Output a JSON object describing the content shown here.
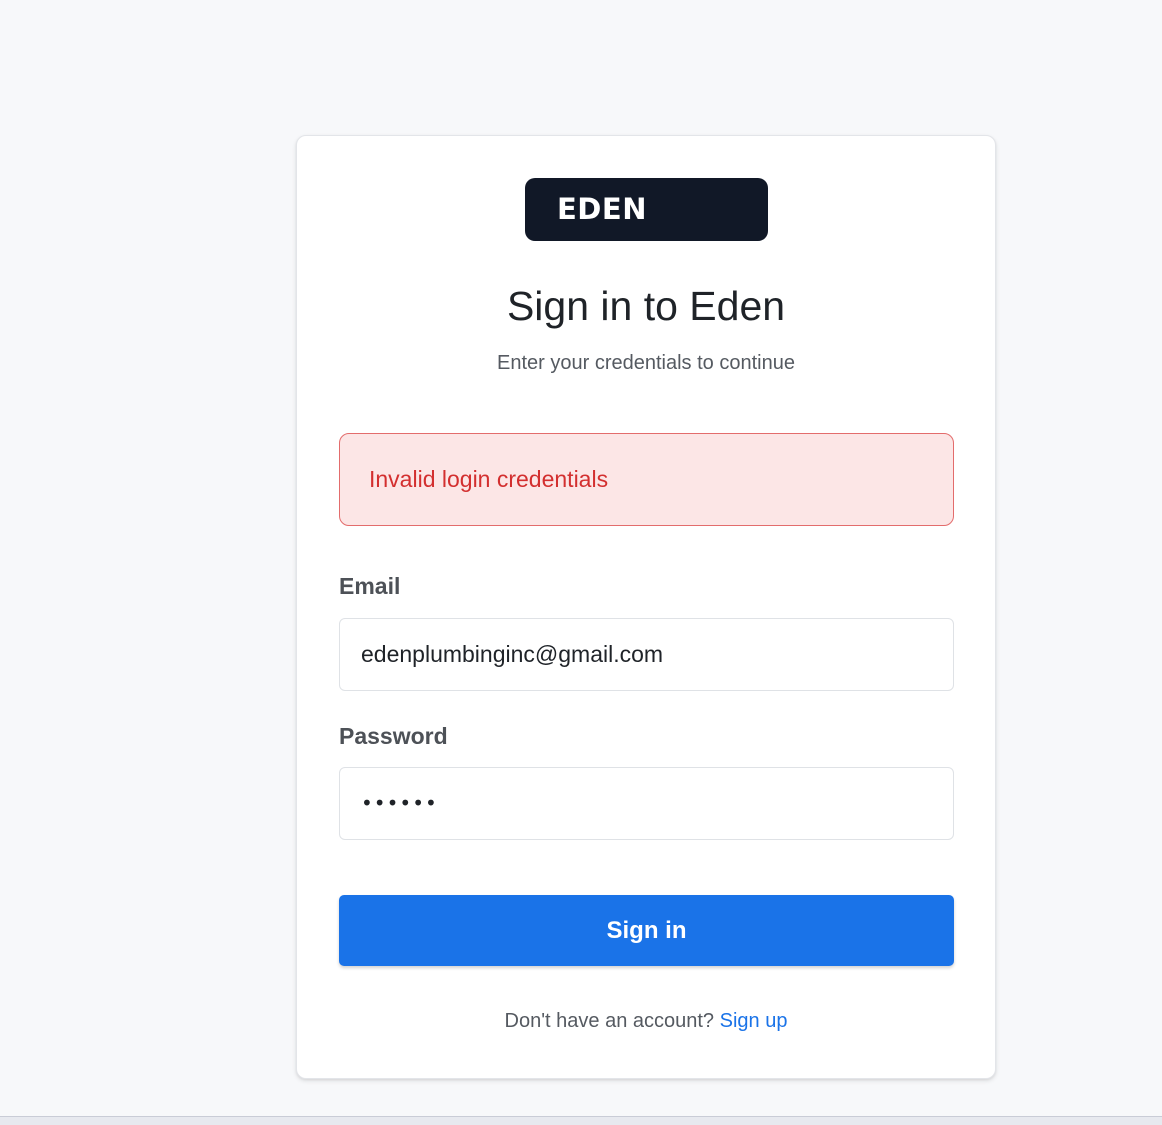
{
  "logo": {
    "text": "EDEN"
  },
  "heading": {
    "title": "Sign in to Eden",
    "subtitle": "Enter your credentials to continue"
  },
  "alert": {
    "message": "Invalid login credentials"
  },
  "form": {
    "email_label": "Email",
    "email_value": "edenplumbinginc@gmail.com",
    "password_label": "Password",
    "password_value": "••••••",
    "submit_label": "Sign in"
  },
  "footer": {
    "prompt": "Don't have an account?",
    "link": "Sign up"
  },
  "colors": {
    "primary": "#1a73e8",
    "error_text": "#d32f2f",
    "error_bg": "#fce6e6",
    "logo_bg": "#111827"
  }
}
